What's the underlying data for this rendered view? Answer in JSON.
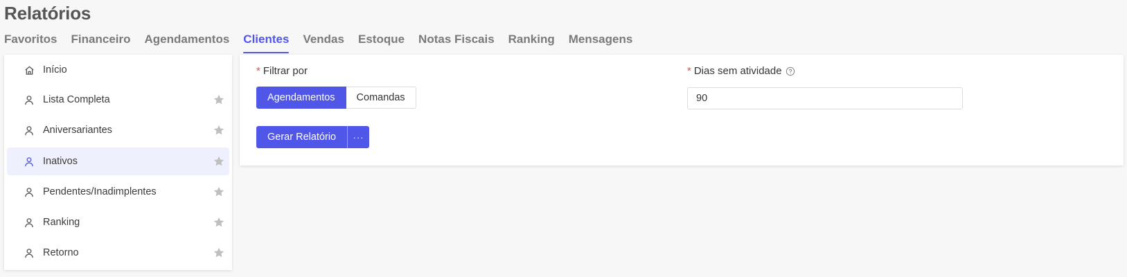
{
  "page": {
    "title": "Relatórios"
  },
  "tabs": [
    {
      "label": "Favoritos",
      "active": false
    },
    {
      "label": "Financeiro",
      "active": false
    },
    {
      "label": "Agendamentos",
      "active": false
    },
    {
      "label": "Clientes",
      "active": true
    },
    {
      "label": "Vendas",
      "active": false
    },
    {
      "label": "Estoque",
      "active": false
    },
    {
      "label": "Notas Fiscais",
      "active": false
    },
    {
      "label": "Ranking",
      "active": false
    },
    {
      "label": "Mensagens",
      "active": false
    }
  ],
  "sidebar": {
    "items": [
      {
        "label": "Início",
        "icon": "home-icon",
        "favoritable": false
      },
      {
        "label": "Lista Completa",
        "icon": "user-icon",
        "favoritable": true
      },
      {
        "label": "Aniversariantes",
        "icon": "user-icon",
        "favoritable": true
      },
      {
        "label": "Inativos",
        "icon": "user-icon",
        "favoritable": true,
        "active": true
      },
      {
        "label": "Pendentes/Inadimplentes",
        "icon": "user-icon",
        "favoritable": true
      },
      {
        "label": "Ranking",
        "icon": "user-icon",
        "favoritable": true
      },
      {
        "label": "Retorno",
        "icon": "user-icon",
        "favoritable": true
      }
    ]
  },
  "form": {
    "filter": {
      "required_mark": "*",
      "label": "Filtrar por",
      "options": [
        "Agendamentos",
        "Comandas"
      ],
      "selected": "Agendamentos"
    },
    "days": {
      "required_mark": "*",
      "label": "Dias sem atividade",
      "value": "90",
      "help_icon": "question-circle-icon"
    },
    "generate": {
      "label": "Gerar Relatório",
      "more_label": "···"
    }
  },
  "colors": {
    "accent": "#4f56e8",
    "active_item_bg": "#eef0fd",
    "star": "#bfbfbf",
    "required": "#e5484d",
    "background": "#f7f7f7"
  }
}
